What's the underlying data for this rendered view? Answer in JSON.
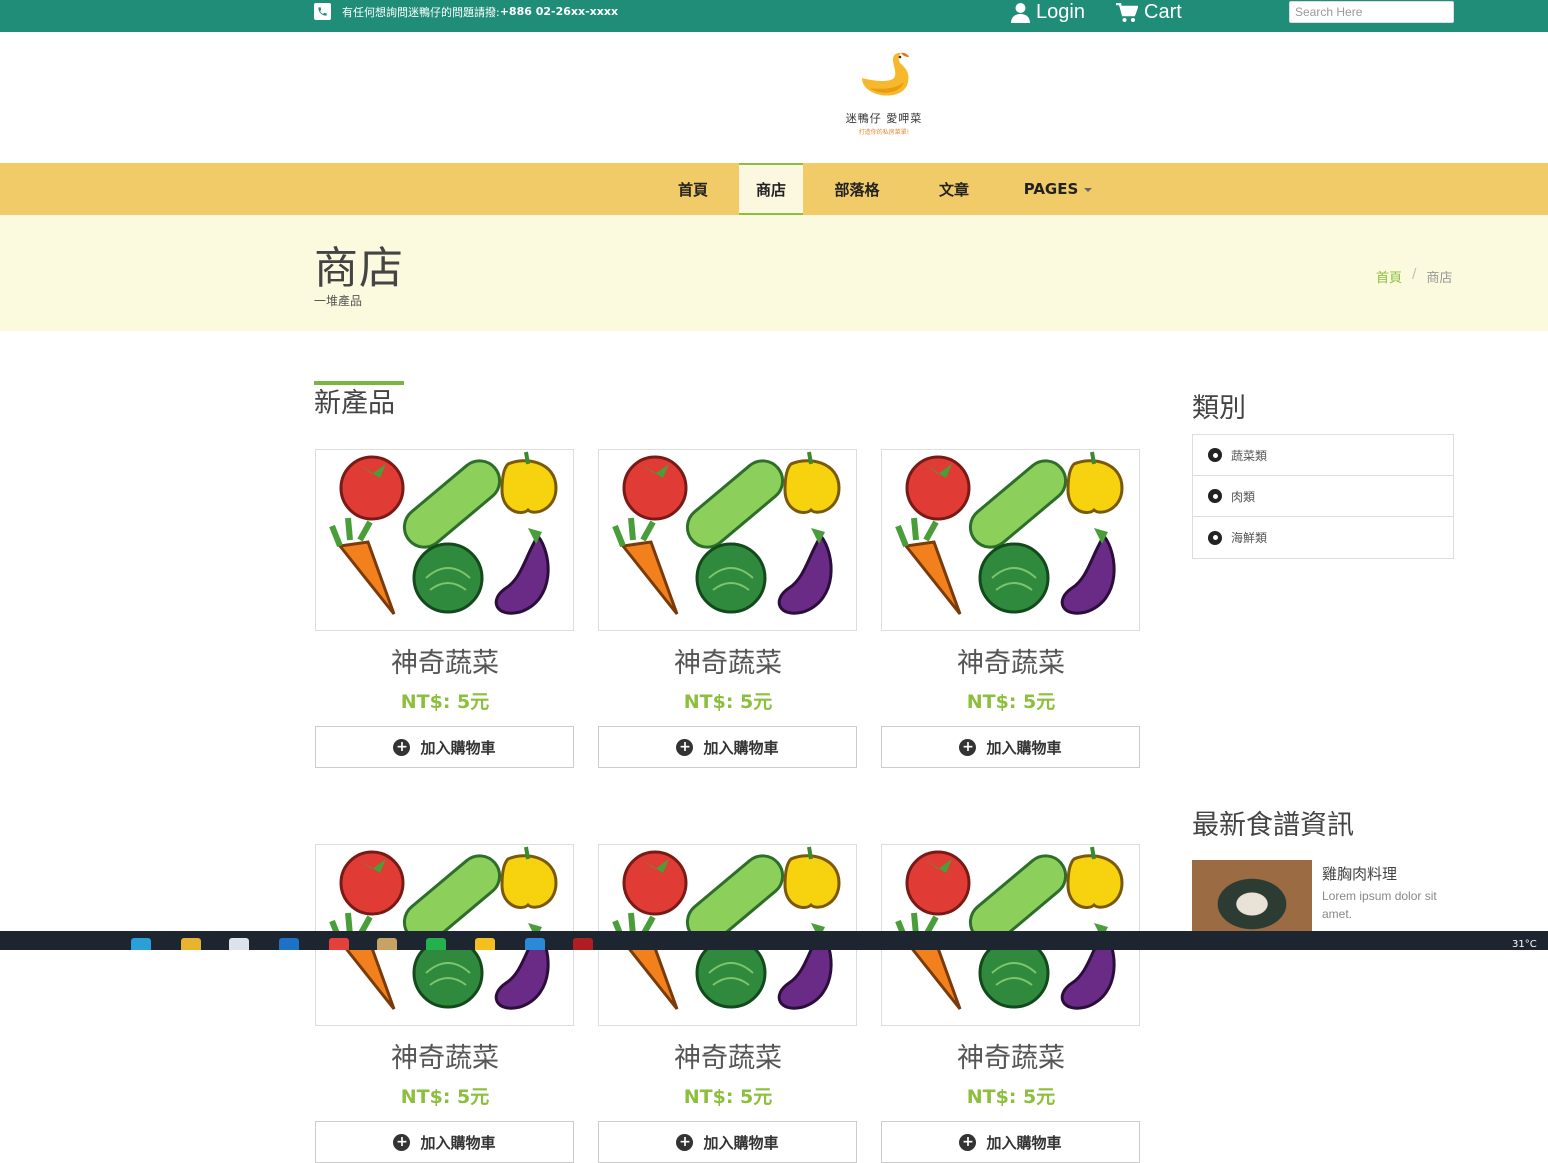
{
  "topbar": {
    "phone_text": "有任何想詢問迷鴨仔的問題請撥: ",
    "phone_number": "+886 02-26xx-xxxx",
    "login_label": "Login",
    "cart_label": "Cart",
    "search_placeholder": "Search Here",
    "background": "#1f8d78"
  },
  "logo": {
    "brand": "迷鴨仔 愛呷菜",
    "slogan": "打造你的私房菜單!"
  },
  "nav": {
    "items": [
      {
        "label": "首頁"
      },
      {
        "label": "商店",
        "active": true
      },
      {
        "label": "部落格"
      },
      {
        "label": "文章"
      },
      {
        "label": "PAGES",
        "dropdown": true
      }
    ],
    "background": "#f2cb69"
  },
  "page_header": {
    "title": "商店",
    "subtitle": "一堆產品",
    "breadcrumb": {
      "home": "首頁",
      "separator": "/",
      "current": "商店"
    }
  },
  "main": {
    "section_title": "新產品",
    "products": [
      {
        "name": "神奇蔬菜",
        "price": "NT$: 5元",
        "button": "加入購物車"
      },
      {
        "name": "神奇蔬菜",
        "price": "NT$: 5元",
        "button": "加入購物車"
      },
      {
        "name": "神奇蔬菜",
        "price": "NT$: 5元",
        "button": "加入購物車"
      },
      {
        "name": "神奇蔬菜",
        "price": "NT$: 5元",
        "button": "加入購物車"
      },
      {
        "name": "神奇蔬菜",
        "price": "NT$: 5元",
        "button": "加入購物車"
      },
      {
        "name": "神奇蔬菜",
        "price": "NT$: 5元",
        "button": "加入購物車"
      }
    ],
    "accent_color": "#8bbf3c"
  },
  "sidebar": {
    "categories_title": "類別",
    "categories": [
      {
        "label": "蔬菜類"
      },
      {
        "label": "肉類"
      },
      {
        "label": "海鮮類"
      }
    ],
    "recipes_title": "最新食譜資訊",
    "recipes": [
      {
        "title": "雞胸肉料理",
        "desc": "Lorem ipsum dolor sit amet."
      }
    ]
  },
  "taskbar": {
    "temperature": "31°C"
  }
}
